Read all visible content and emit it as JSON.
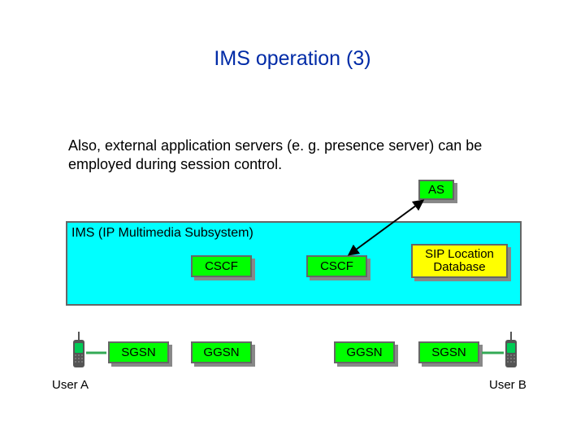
{
  "title": "IMS operation (3)",
  "body": "Also, external application servers (e. g. presence server) can be employed during session control.",
  "ims_box_label": "IMS (IP Multimedia Subsystem)",
  "nodes": {
    "as": "AS",
    "cscf_left": "CSCF",
    "cscf_right": "CSCF",
    "sip_db_line1": "SIP Location",
    "sip_db_line2": "Database",
    "sgsn_left": "SGSN",
    "ggsn_left": "GGSN",
    "ggsn_right": "GGSN",
    "sgsn_right": "SGSN"
  },
  "users": {
    "a": "User A",
    "b": "User B"
  }
}
